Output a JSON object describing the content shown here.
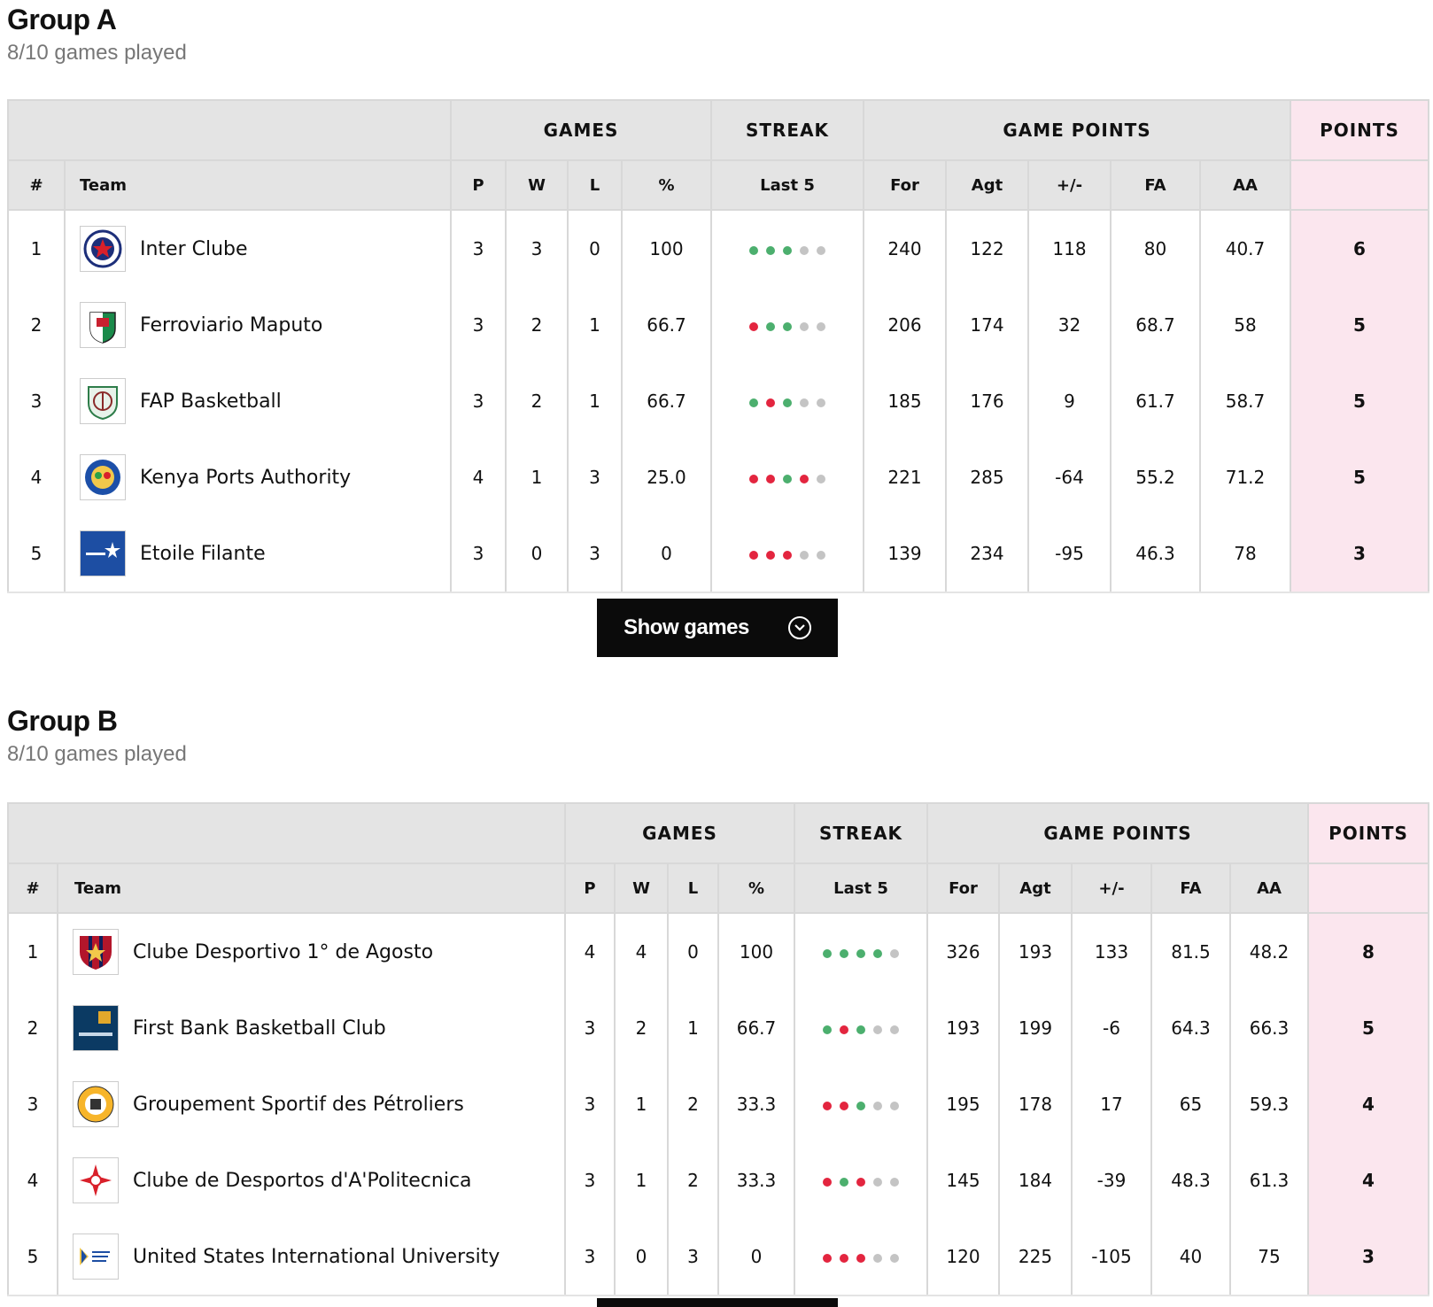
{
  "colors": {
    "win": "#4caf6e",
    "loss": "#e3253f",
    "empty": "#c4c4c4",
    "points_bg": "#fbe6ee",
    "header_bg": "#e4e4e4"
  },
  "labels": {
    "games": "GAMES",
    "streak": "STREAK",
    "game_points": "GAME POINTS",
    "points": "POINTS",
    "rank": "#",
    "team": "Team",
    "p": "P",
    "w": "W",
    "l": "L",
    "pct": "%",
    "last5": "Last 5",
    "for": "For",
    "agt": "Agt",
    "diff": "+/-",
    "fa": "FA",
    "aa": "AA",
    "show_games": "Show games"
  },
  "groups": [
    {
      "title": "Group A",
      "subtitle": "8/10 games played",
      "teams": [
        {
          "rank": "1",
          "name": "Inter Clube",
          "logo": "inter-clube-logo",
          "p": "3",
          "w": "3",
          "l": "0",
          "pct": "100",
          "streak": [
            "W",
            "W",
            "W",
            "-",
            "-"
          ],
          "for": "240",
          "agt": "122",
          "diff": "118",
          "fa": "80",
          "aa": "40.7",
          "pts": "6"
        },
        {
          "rank": "2",
          "name": "Ferroviario Maputo",
          "logo": "ferroviario-maputo-logo",
          "p": "3",
          "w": "2",
          "l": "1",
          "pct": "66.7",
          "streak": [
            "L",
            "W",
            "W",
            "-",
            "-"
          ],
          "for": "206",
          "agt": "174",
          "diff": "32",
          "fa": "68.7",
          "aa": "58",
          "pts": "5"
        },
        {
          "rank": "3",
          "name": "FAP Basketball",
          "logo": "fap-basketball-logo",
          "p": "3",
          "w": "2",
          "l": "1",
          "pct": "66.7",
          "streak": [
            "W",
            "L",
            "W",
            "-",
            "-"
          ],
          "for": "185",
          "agt": "176",
          "diff": "9",
          "fa": "61.7",
          "aa": "58.7",
          "pts": "5"
        },
        {
          "rank": "4",
          "name": "Kenya Ports Authority",
          "logo": "kenya-ports-authority-logo",
          "p": "4",
          "w": "1",
          "l": "3",
          "pct": "25.0",
          "streak": [
            "L",
            "L",
            "W",
            "L",
            "-"
          ],
          "for": "221",
          "agt": "285",
          "diff": "-64",
          "fa": "55.2",
          "aa": "71.2",
          "pts": "5"
        },
        {
          "rank": "5",
          "name": "Etoile Filante",
          "logo": "etoile-filante-logo",
          "p": "3",
          "w": "0",
          "l": "3",
          "pct": "0",
          "streak": [
            "L",
            "L",
            "L",
            "-",
            "-"
          ],
          "for": "139",
          "agt": "234",
          "diff": "-95",
          "fa": "46.3",
          "aa": "78",
          "pts": "3"
        }
      ]
    },
    {
      "title": "Group B",
      "subtitle": "8/10 games played",
      "teams": [
        {
          "rank": "1",
          "name": "Clube Desportivo 1° de Agosto",
          "logo": "primeiro-de-agosto-logo",
          "p": "4",
          "w": "4",
          "l": "0",
          "pct": "100",
          "streak": [
            "W",
            "W",
            "W",
            "W",
            "-"
          ],
          "for": "326",
          "agt": "193",
          "diff": "133",
          "fa": "81.5",
          "aa": "48.2",
          "pts": "8"
        },
        {
          "rank": "2",
          "name": "First Bank Basketball Club",
          "logo": "first-bank-logo",
          "p": "3",
          "w": "2",
          "l": "1",
          "pct": "66.7",
          "streak": [
            "W",
            "L",
            "W",
            "-",
            "-"
          ],
          "for": "193",
          "agt": "199",
          "diff": "-6",
          "fa": "64.3",
          "aa": "66.3",
          "pts": "5"
        },
        {
          "rank": "3",
          "name": "Groupement Sportif des Pétroliers",
          "logo": "gs-petroliers-logo",
          "p": "3",
          "w": "1",
          "l": "2",
          "pct": "33.3",
          "streak": [
            "L",
            "L",
            "W",
            "-",
            "-"
          ],
          "for": "195",
          "agt": "178",
          "diff": "17",
          "fa": "65",
          "aa": "59.3",
          "pts": "4"
        },
        {
          "rank": "4",
          "name": "Clube de Desportos d'A'Politecnica",
          "logo": "a-politecnica-logo",
          "p": "3",
          "w": "1",
          "l": "2",
          "pct": "33.3",
          "streak": [
            "L",
            "W",
            "L",
            "-",
            "-"
          ],
          "for": "145",
          "agt": "184",
          "diff": "-39",
          "fa": "48.3",
          "aa": "61.3",
          "pts": "4"
        },
        {
          "rank": "5",
          "name": "United States International University",
          "logo": "usiu-logo",
          "p": "3",
          "w": "0",
          "l": "3",
          "pct": "0",
          "streak": [
            "L",
            "L",
            "L",
            "-",
            "-"
          ],
          "for": "120",
          "agt": "225",
          "diff": "-105",
          "fa": "40",
          "aa": "75",
          "pts": "3"
        }
      ]
    }
  ]
}
